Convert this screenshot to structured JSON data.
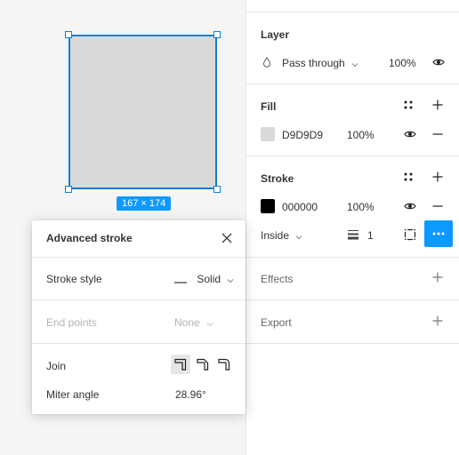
{
  "canvas": {
    "size_badge": "167 × 174",
    "shape_fill": "#D9D9D9",
    "selection_color": "#0D7FD4"
  },
  "panel": {
    "layer": {
      "heading": "Layer",
      "blend_mode": "Pass through",
      "opacity": "100%"
    },
    "fill": {
      "heading": "Fill",
      "color_hex": "D9D9D9",
      "color": "#D9D9D9",
      "opacity": "100%"
    },
    "stroke": {
      "heading": "Stroke",
      "color_hex": "000000",
      "color": "#000000",
      "opacity": "100%",
      "position": "Inside",
      "weight": "1"
    },
    "effects": {
      "heading": "Effects"
    },
    "export": {
      "heading": "Export"
    }
  },
  "popover": {
    "title": "Advanced stroke",
    "stroke_style_label": "Stroke style",
    "stroke_style_value": "Solid",
    "end_points_label": "End points",
    "end_points_value": "None",
    "join_label": "Join",
    "miter_label": "Miter angle",
    "miter_value": "28.96°"
  },
  "colors": {
    "accent": "#0D99FF",
    "divider": "#E6E6E6"
  }
}
